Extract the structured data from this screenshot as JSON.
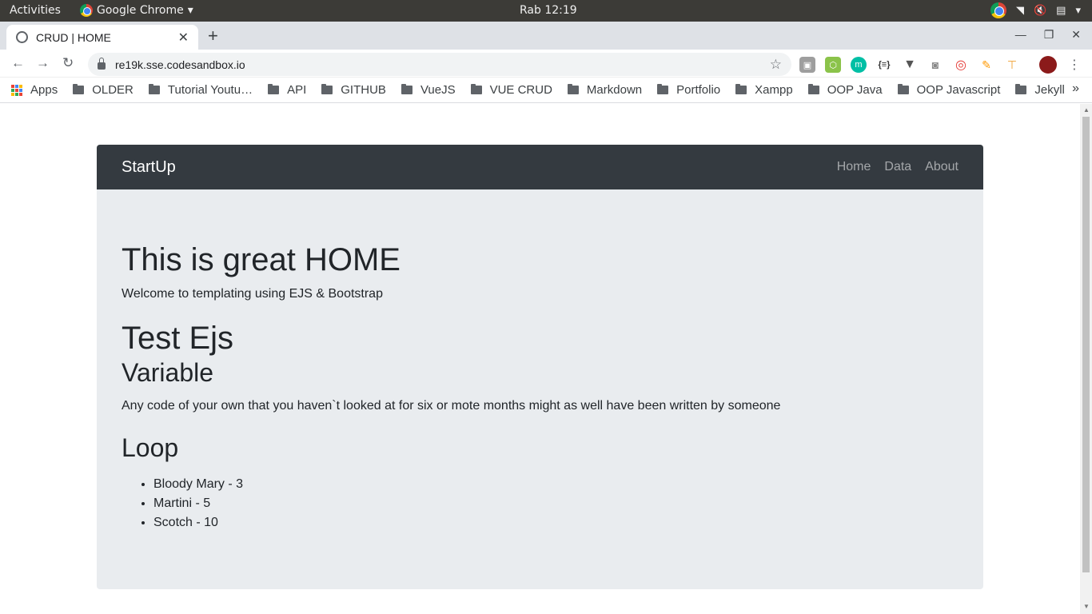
{
  "os": {
    "activities": "Activities",
    "app_name": "Google Chrome",
    "clock": "Rab 12:19"
  },
  "browser": {
    "tab_title": "CRUD | HOME",
    "url": "re19k.sse.codesandbox.io",
    "bookmarks": [
      "Apps",
      "OLDER",
      "Tutorial Youtu…",
      "API",
      "GITHUB",
      "VueJS",
      "VUE CRUD",
      "Markdown",
      "Portfolio",
      "Xampp",
      "OOP Java",
      "OOP Javascript",
      "Jekyll"
    ],
    "bookmarks_more": "»"
  },
  "page": {
    "brand": "StartUp",
    "nav": [
      "Home",
      "Data",
      "About"
    ],
    "heading": "This is great HOME",
    "lead": "Welcome to templating using EJS & Bootstrap",
    "section_title": "Test Ejs",
    "variable_title": "Variable",
    "variable_text": "Any code of your own that you haven`t looked at for six or mote months might as well have been written by someone",
    "loop_title": "Loop",
    "loop_items": [
      "Bloody Mary - 3",
      "Martini - 5",
      "Scotch - 10"
    ]
  },
  "colors": {
    "navbar": "#343a40",
    "jumbotron": "#e9ecef",
    "ubuntu_bar": "#3c3b37"
  }
}
